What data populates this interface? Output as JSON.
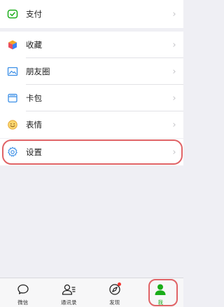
{
  "menu": {
    "pay": {
      "label": "支付",
      "icon": "pay-icon"
    },
    "favorites": {
      "label": "收藏",
      "icon": "favorites-cube-icon"
    },
    "moments": {
      "label": "朋友圈",
      "icon": "moments-image-icon"
    },
    "cards": {
      "label": "卡包",
      "icon": "card-wallet-icon"
    },
    "stickers": {
      "label": "表情",
      "icon": "emoji-smile-icon"
    },
    "settings": {
      "label": "设置",
      "icon": "gear-icon"
    },
    "chevron": "›"
  },
  "tabs": [
    {
      "label": "微信",
      "icon": "chat-bubble-icon",
      "active": false
    },
    {
      "label": "通讯录",
      "icon": "contacts-icon",
      "active": false
    },
    {
      "label": "发现",
      "icon": "compass-icon",
      "active": false,
      "badge": true
    },
    {
      "label": "我",
      "icon": "person-icon",
      "active": true
    }
  ],
  "colors": {
    "accent": "#1aad19",
    "highlight": "#e06366",
    "badge": "#f43530",
    "background": "#efeff4"
  }
}
